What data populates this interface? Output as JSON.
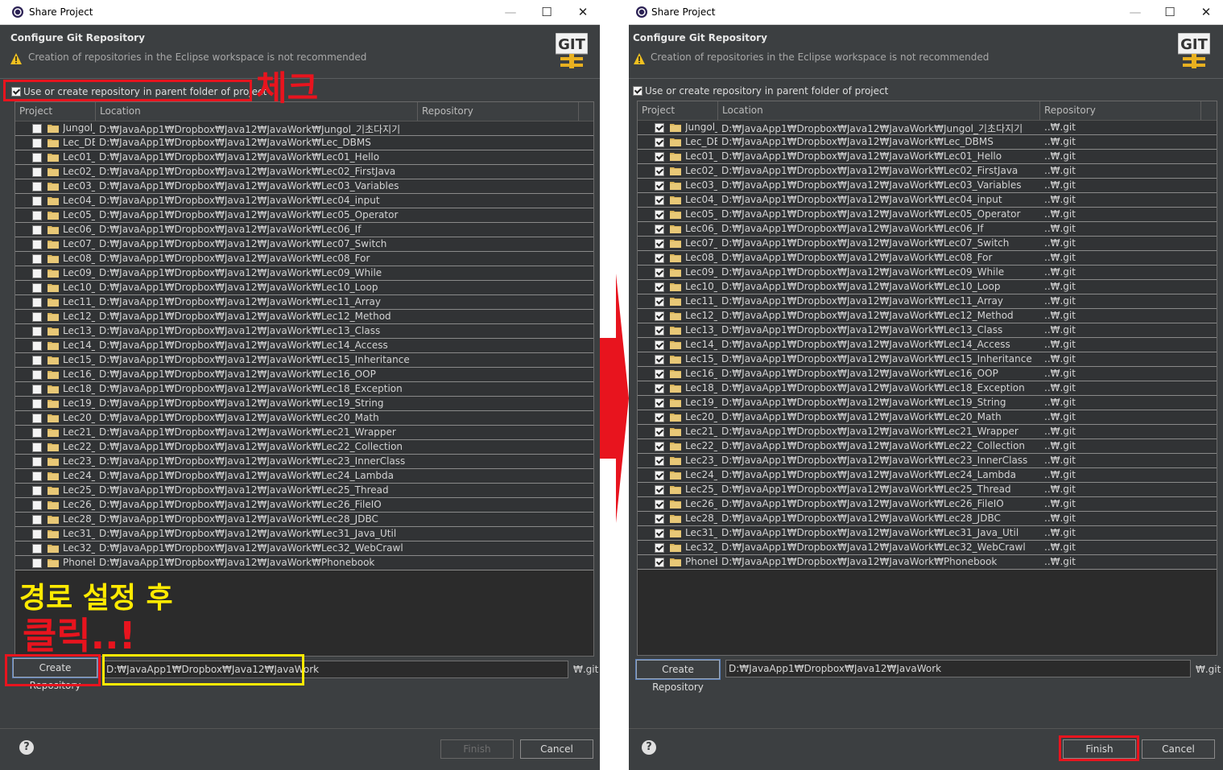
{
  "window": {
    "title": "Share Project"
  },
  "header": {
    "title": "Configure Git Repository",
    "warning": "Creation of repositories in the Eclipse workspace is not recommended",
    "logo_text": "GIT"
  },
  "option": {
    "label": "Use or create repository in parent folder of project"
  },
  "columns": {
    "project": "Project",
    "location": "Location",
    "repository": "Repository"
  },
  "projects": [
    {
      "name": "Jungol_",
      "location": "D:₩JavaApp1₩Dropbox₩Java12₩JavaWork₩Jungol_기초다지기"
    },
    {
      "name": "Lec_DB",
      "location": "D:₩JavaApp1₩Dropbox₩Java12₩JavaWork₩Lec_DBMS"
    },
    {
      "name": "Lec01_I",
      "location": "D:₩JavaApp1₩Dropbox₩Java12₩JavaWork₩Lec01_Hello"
    },
    {
      "name": "Lec02_F",
      "location": "D:₩JavaApp1₩Dropbox₩Java12₩JavaWork₩Lec02_FirstJava"
    },
    {
      "name": "Lec03_V",
      "location": "D:₩JavaApp1₩Dropbox₩Java12₩JavaWork₩Lec03_Variables"
    },
    {
      "name": "Lec04_i",
      "location": "D:₩JavaApp1₩Dropbox₩Java12₩JavaWork₩Lec04_input"
    },
    {
      "name": "Lec05_C",
      "location": "D:₩JavaApp1₩Dropbox₩Java12₩JavaWork₩Lec05_Operator"
    },
    {
      "name": "Lec06_I",
      "location": "D:₩JavaApp1₩Dropbox₩Java12₩JavaWork₩Lec06_If"
    },
    {
      "name": "Lec07_S",
      "location": "D:₩JavaApp1₩Dropbox₩Java12₩JavaWork₩Lec07_Switch"
    },
    {
      "name": "Lec08_F",
      "location": "D:₩JavaApp1₩Dropbox₩Java12₩JavaWork₩Lec08_For"
    },
    {
      "name": "Lec09_V",
      "location": "D:₩JavaApp1₩Dropbox₩Java12₩JavaWork₩Lec09_While"
    },
    {
      "name": "Lec10_L",
      "location": "D:₩JavaApp1₩Dropbox₩Java12₩JavaWork₩Lec10_Loop"
    },
    {
      "name": "Lec11_A",
      "location": "D:₩JavaApp1₩Dropbox₩Java12₩JavaWork₩Lec11_Array"
    },
    {
      "name": "Lec12_M",
      "location": "D:₩JavaApp1₩Dropbox₩Java12₩JavaWork₩Lec12_Method"
    },
    {
      "name": "Lec13_C",
      "location": "D:₩JavaApp1₩Dropbox₩Java12₩JavaWork₩Lec13_Class"
    },
    {
      "name": "Lec14_A",
      "location": "D:₩JavaApp1₩Dropbox₩Java12₩JavaWork₩Lec14_Access"
    },
    {
      "name": "Lec15_I",
      "location": "D:₩JavaApp1₩Dropbox₩Java12₩JavaWork₩Lec15_Inheritance"
    },
    {
      "name": "Lec16_C",
      "location": "D:₩JavaApp1₩Dropbox₩Java12₩JavaWork₩Lec16_OOP"
    },
    {
      "name": "Lec18_E",
      "location": "D:₩JavaApp1₩Dropbox₩Java12₩JavaWork₩Lec18_Exception"
    },
    {
      "name": "Lec19_S",
      "location": "D:₩JavaApp1₩Dropbox₩Java12₩JavaWork₩Lec19_String"
    },
    {
      "name": "Lec20_M",
      "location": "D:₩JavaApp1₩Dropbox₩Java12₩JavaWork₩Lec20_Math"
    },
    {
      "name": "Lec21_V",
      "location": "D:₩JavaApp1₩Dropbox₩Java12₩JavaWork₩Lec21_Wrapper"
    },
    {
      "name": "Lec22_C",
      "location": "D:₩JavaApp1₩Dropbox₩Java12₩JavaWork₩Lec22_Collection"
    },
    {
      "name": "Lec23_I",
      "location": "D:₩JavaApp1₩Dropbox₩Java12₩JavaWork₩Lec23_InnerClass"
    },
    {
      "name": "Lec24_L",
      "location": "D:₩JavaApp1₩Dropbox₩Java12₩JavaWork₩Lec24_Lambda"
    },
    {
      "name": "Lec25_T",
      "location": "D:₩JavaApp1₩Dropbox₩Java12₩JavaWork₩Lec25_Thread"
    },
    {
      "name": "Lec26_F",
      "location": "D:₩JavaApp1₩Dropbox₩Java12₩JavaWork₩Lec26_FileIO"
    },
    {
      "name": "Lec28_J",
      "location": "D:₩JavaApp1₩Dropbox₩Java12₩JavaWork₩Lec28_JDBC"
    },
    {
      "name": "Lec31_J",
      "location": "D:₩JavaApp1₩Dropbox₩Java12₩JavaWork₩Lec31_Java_Util"
    },
    {
      "name": "Lec32_V",
      "location": "D:₩JavaApp1₩Dropbox₩Java12₩JavaWork₩Lec32_WebCrawl"
    },
    {
      "name": "Phoneb",
      "location": "D:₩JavaApp1₩Dropbox₩Java12₩JavaWork₩Phonebook"
    }
  ],
  "repo_value": "..₩.git",
  "create_repository_label": "Create Repository",
  "repository_path": "D:₩JavaApp1₩Dropbox₩Java12₩JavaWork",
  "git_suffix": "₩.git",
  "buttons": {
    "help": "?",
    "finish": "Finish",
    "cancel": "Cancel"
  },
  "annotations": {
    "check": "체크",
    "path_then": "경로 설정 후",
    "click": "클릭..!"
  },
  "colors": {
    "annotation_red": "#e8141e",
    "annotation_yellow": "#ffea00",
    "dialog_bg": "#3c3f41"
  },
  "state": {
    "left_checked": false,
    "right_checked": true,
    "left_finish_enabled": false,
    "right_finish_enabled": true
  }
}
